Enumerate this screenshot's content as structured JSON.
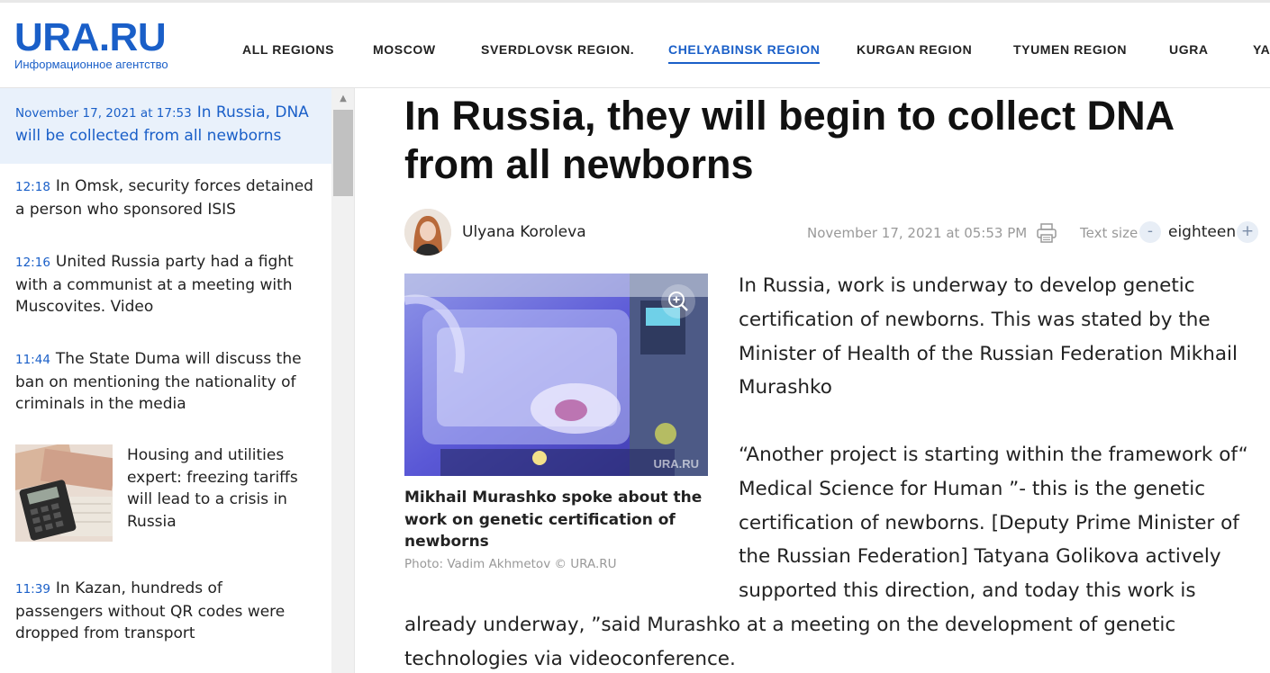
{
  "header": {
    "logo_main": "URA.RU",
    "logo_sub": "Информационное агентство",
    "nav": [
      {
        "label": "ALL REGIONS",
        "active": false
      },
      {
        "label": "MOSCOW",
        "active": false
      },
      {
        "label": "SVERDLOVSK REGION.",
        "active": false
      },
      {
        "label": "CHELYABINSK REGION",
        "active": true
      },
      {
        "label": "KURGAN REGION",
        "active": false
      },
      {
        "label": "TYUMEN REGION",
        "active": false
      },
      {
        "label": "UGRA",
        "active": false
      },
      {
        "label": "YA",
        "active": false
      }
    ]
  },
  "sidebar": {
    "items": [
      {
        "time": "November 17, 2021 at 17:53",
        "text": "In Russia, DNA will be collected from all newborns"
      },
      {
        "time": "12:18",
        "text": "In Omsk, security forces detained a person who sponsored ISIS"
      },
      {
        "time": "12:16",
        "text": "United Russia party had a fight with a communist at a meeting with Muscovites. Video"
      },
      {
        "time": "11:44",
        "text": "The State Duma will discuss the ban on mentioning the nationality of criminals in the media"
      },
      {
        "time": "",
        "text": "Housing and utilities expert: freezing tariffs will lead to a crisis in Russia"
      },
      {
        "time": "11:39",
        "text": "In Kazan, hundreds of passengers without QR codes were dropped from transport"
      }
    ]
  },
  "article": {
    "title": "In Russia, they will begin to collect DNA from all newborns",
    "author": "Ulyana Koroleva",
    "date": "November 17, 2021 at 05:53 PM",
    "text_size_label": "Text size",
    "text_size_minus": "-",
    "text_size_value": "eighteen",
    "text_size_plus": "+",
    "photo_watermark": "URA.RU",
    "caption": "Mikhail Murashko spoke about the work on genetic certification of newborns",
    "photo_credit": "Photo: Vadim Akhmetov © URA.RU",
    "paragraph1": "In Russia, work is underway to develop genetic certification of newborns. This was stated by the Minister of Health of the Russian Federation Mikhail Murashko",
    "paragraph2_lines": [
      "“Another project is starting within the framework of“",
      "Medical Science for Human ”- this is the genetic",
      "certification of newborns. [Deputy Prime Minister of",
      "the Russian Federation] Tatyana Golikova actively",
      "supported this direction, and today this work is"
    ],
    "paragraph2_tail": [
      "already underway, ”said Murashko at a meeting on the development of genetic",
      "technologies via videoconference."
    ]
  }
}
